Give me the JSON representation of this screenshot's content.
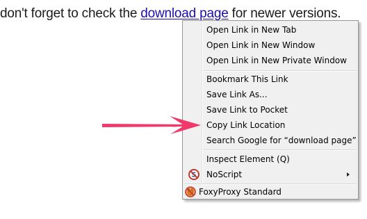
{
  "page": {
    "text_before": "don't forget to check the ",
    "link_text": "download page",
    "text_after": " for newer versions."
  },
  "context_menu": {
    "items": [
      {
        "label": "Open Link in New Tab"
      },
      {
        "label": "Open Link in New Window"
      },
      {
        "label": "Open Link in New Private Window"
      },
      {
        "label": "Bookmark This Link"
      },
      {
        "label": "Save Link As..."
      },
      {
        "label": "Save Link to Pocket"
      },
      {
        "label": "Copy Link Location"
      },
      {
        "label": "Search Google for “download page”"
      },
      {
        "label": "Inspect Element (Q)"
      },
      {
        "label": "NoScript",
        "icon": "noscript-icon",
        "has_submenu": true
      },
      {
        "label": "FoxyProxy Standard",
        "icon": "foxyproxy-icon"
      }
    ]
  },
  "annotation": {
    "arrow_color": "#f0386b",
    "arrow_points_to": "Copy Link Location"
  },
  "colors": {
    "link": "#1a0dab",
    "menu_background": "#f0f0f0",
    "menu_border": "#979797"
  }
}
